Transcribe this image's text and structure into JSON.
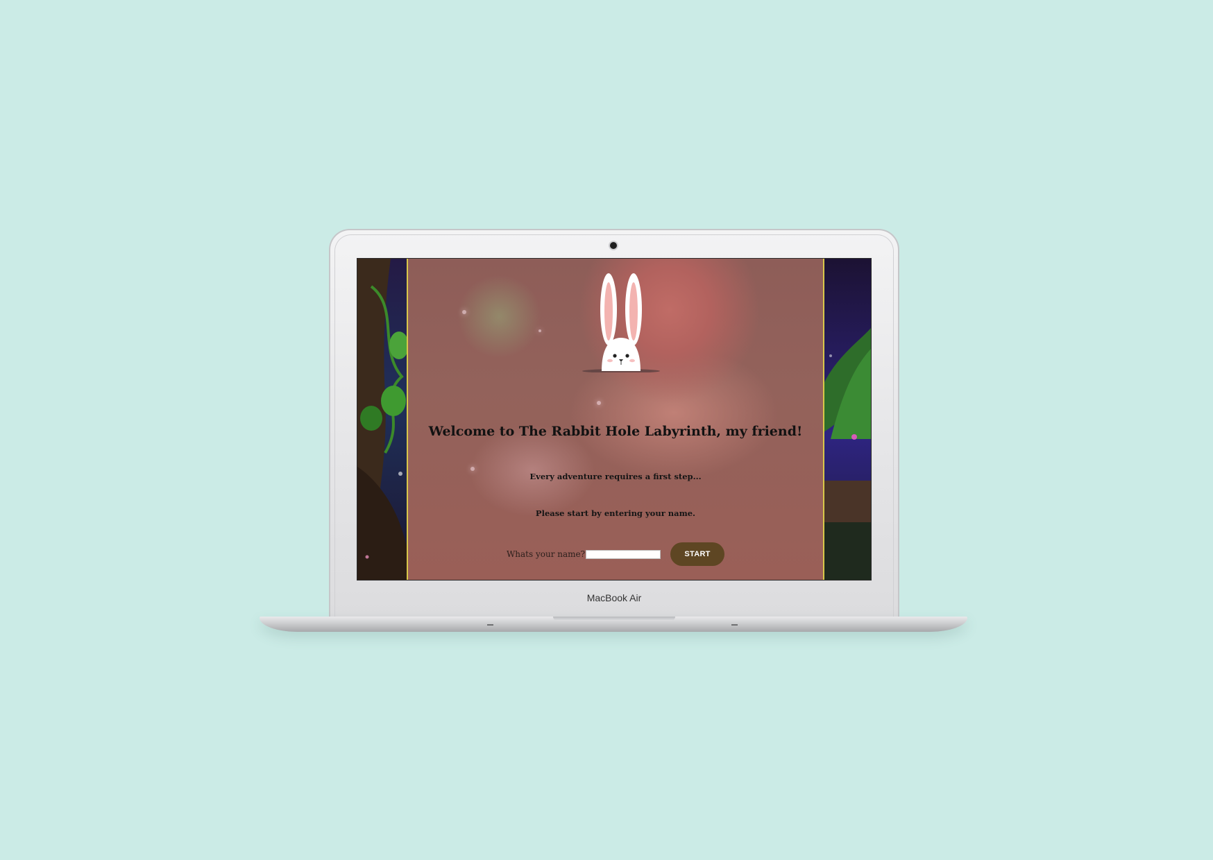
{
  "device": {
    "model_label": "MacBook Air"
  },
  "page": {
    "welcome_title": "Welcome to The Rabbit Hole Labyrinth, my friend!",
    "tagline": "Every adventure requires a first step...",
    "instruction": "Please start by entering your name.",
    "name_form": {
      "label": "Whats your name?",
      "input_value": "",
      "start_button_label": "START"
    }
  },
  "colors": {
    "backdrop": "#cbebe6",
    "panel_border": "#d9c84a",
    "start_button": "#5e4623",
    "panel_overlay": "#93625b"
  },
  "icons": {
    "logo": "bunny-icon"
  }
}
